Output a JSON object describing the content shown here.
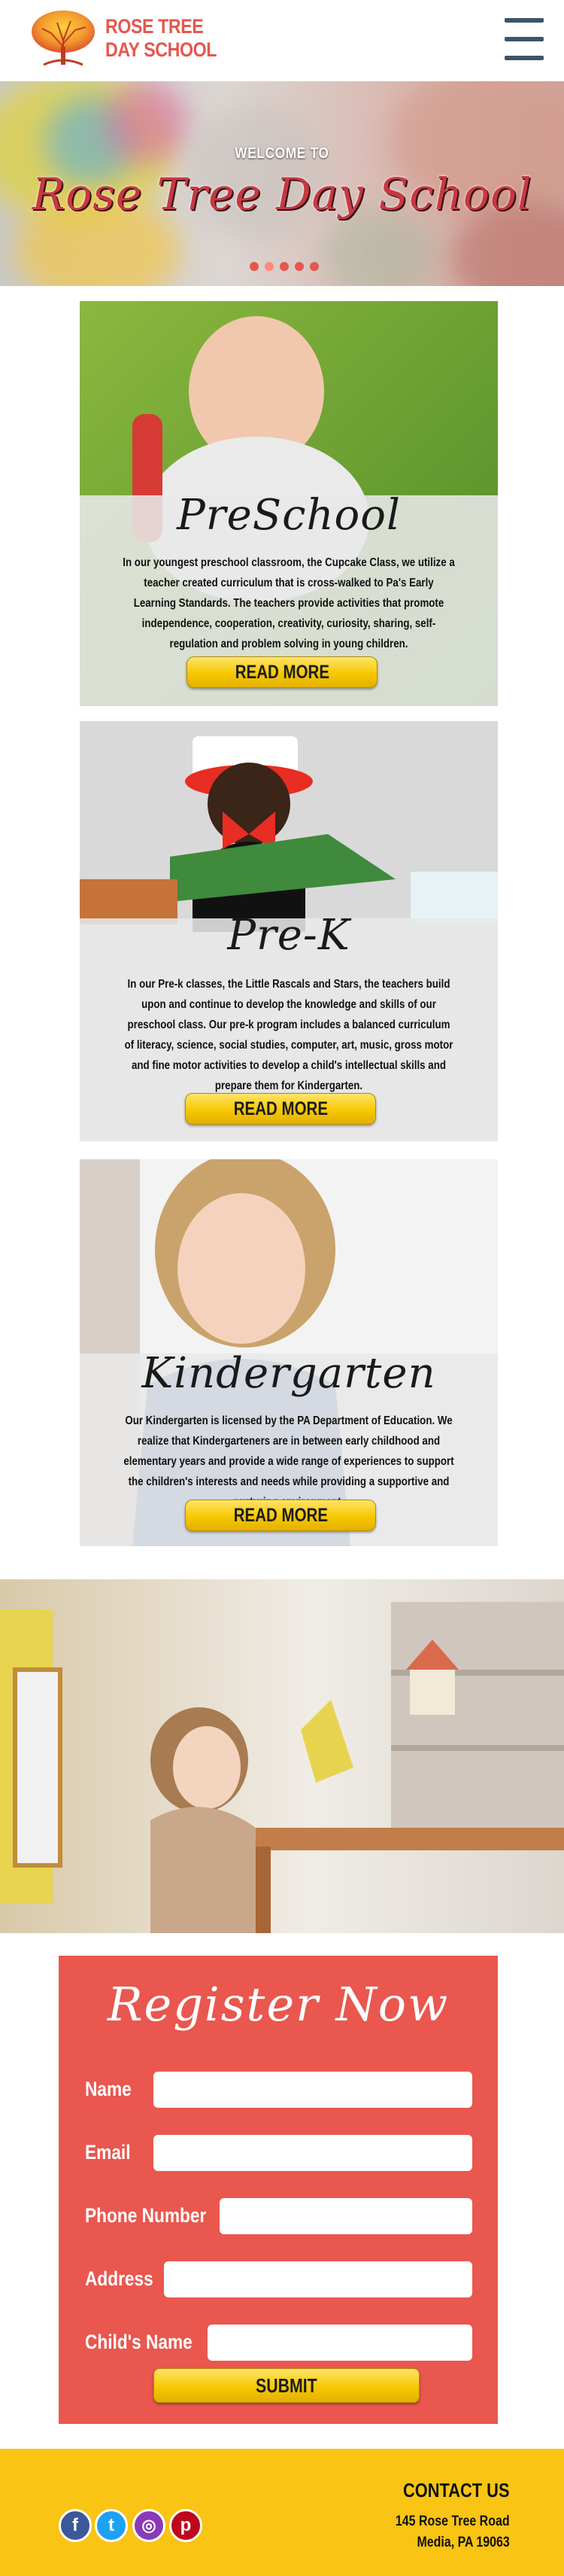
{
  "header": {
    "logo_line1": "ROSE TREE",
    "logo_line2": "DAY SCHOOL",
    "menu_icon": "hamburger-menu-icon"
  },
  "hero": {
    "welcome": "WELCOME TO",
    "title": "Rose Tree Day School",
    "slide_count": 5,
    "active_slide": 2
  },
  "programs": [
    {
      "title": "PreSchool",
      "text": "In our youngest preschool classroom, the Cupcake Class, we utilize a teacher created curriculum that is cross-walked to Pa's Early Learning Standards. The teachers provide activities that promote independence, cooperation, creativity, curiosity, sharing, self-regulation and problem solving in young children.",
      "button": "READ MORE"
    },
    {
      "title": "Pre-K",
      "text": "In our Pre-k classes, the Little Rascals and Stars, the teachers build upon and continue to develop the knowledge and skills of our preschool class. Our pre-k program includes a balanced curriculum of literacy, science, social studies, computer, art, music, gross motor and fine motor activities to develop a child's intellectual skills and prepare them for Kindergarten.",
      "button": "READ MORE"
    },
    {
      "title": "Kindergarten",
      "text": "Our Kindergarten is licensed by the PA Department of Education. We realize that Kindergarteners are in between early childhood and elementary years and provide a wide range of experiences to support the children's interests and needs while providing a supportive and nurturing environment.",
      "button": "READ MORE"
    }
  ],
  "register": {
    "title": "Register Now",
    "fields": [
      {
        "label": "Name",
        "value": "",
        "placeholder": ""
      },
      {
        "label": "Email",
        "value": "",
        "placeholder": ""
      },
      {
        "label": "Phone Number",
        "value": "",
        "placeholder": ""
      },
      {
        "label": "Address",
        "value": "",
        "placeholder": ""
      },
      {
        "label": "Child's Name",
        "value": "",
        "placeholder": ""
      }
    ],
    "submit": "SUBMIT"
  },
  "footer": {
    "social": [
      {
        "icon": "facebook-icon",
        "glyph": "f",
        "color": "#3b5998"
      },
      {
        "icon": "twitter-icon",
        "glyph": "t",
        "color": "#1da1f2"
      },
      {
        "icon": "instagram-icon",
        "glyph": "◎",
        "color": "#8a3ab9"
      },
      {
        "icon": "pinterest-icon",
        "glyph": "p",
        "color": "#bd081c"
      }
    ],
    "contact_title": "CONTACT US",
    "address_line1": "145 Rose Tree Road",
    "address_line2": "Media, PA 19063"
  },
  "colors": {
    "brand_red": "#e5574e",
    "register_bg": "#e9574f",
    "button_yellow": "#f6c800",
    "footer_yellow": "#f9c413",
    "menu_icon": "#3d5468"
  }
}
